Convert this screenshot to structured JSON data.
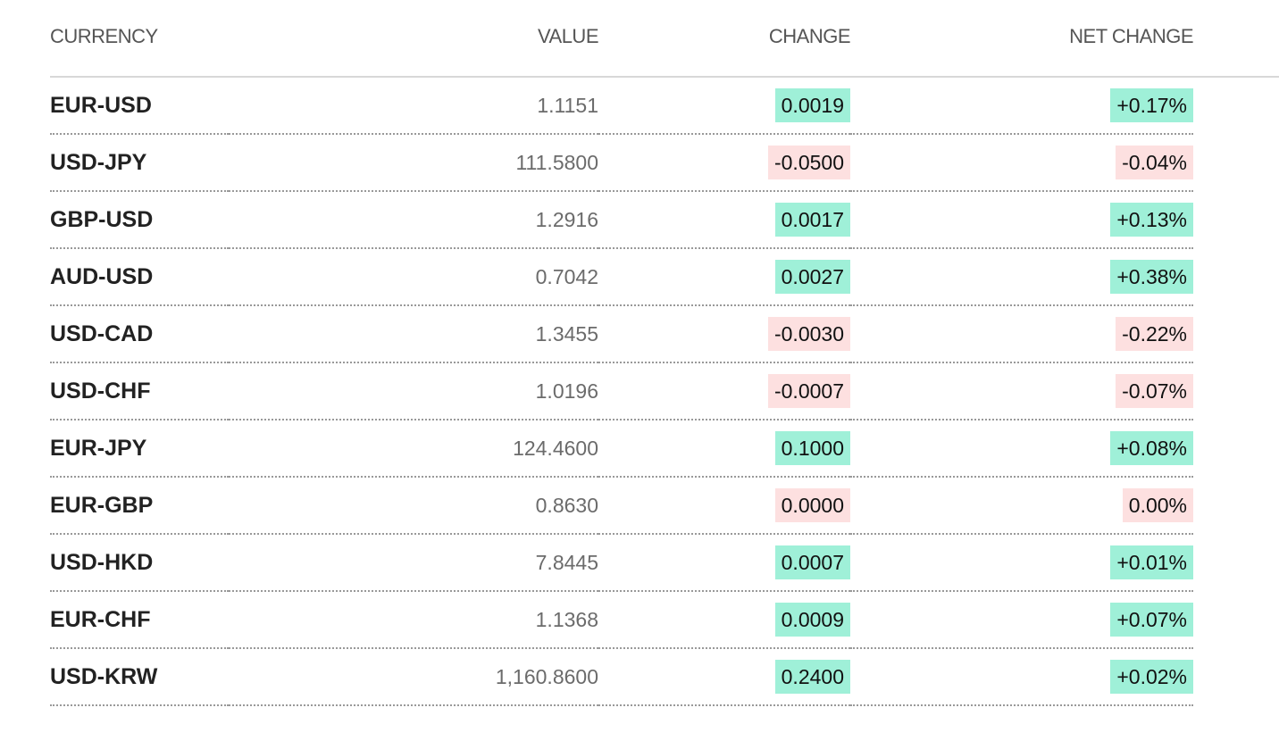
{
  "table": {
    "headers": {
      "currency": "CURRENCY",
      "value": "VALUE",
      "change": "CHANGE",
      "net_change": "NET CHANGE"
    },
    "colors": {
      "positive": "#9ff0d8",
      "negative": "#fde0e0"
    },
    "rows": [
      {
        "currency": "EUR-USD",
        "value": "1.1151",
        "change": "0.0019",
        "net_change": "+0.17%",
        "direction": "up"
      },
      {
        "currency": "USD-JPY",
        "value": "111.5800",
        "change": "-0.0500",
        "net_change": "-0.04%",
        "direction": "down"
      },
      {
        "currency": "GBP-USD",
        "value": "1.2916",
        "change": "0.0017",
        "net_change": "+0.13%",
        "direction": "up"
      },
      {
        "currency": "AUD-USD",
        "value": "0.7042",
        "change": "0.0027",
        "net_change": "+0.38%",
        "direction": "up"
      },
      {
        "currency": "USD-CAD",
        "value": "1.3455",
        "change": "-0.0030",
        "net_change": "-0.22%",
        "direction": "down"
      },
      {
        "currency": "USD-CHF",
        "value": "1.0196",
        "change": "-0.0007",
        "net_change": "-0.07%",
        "direction": "down"
      },
      {
        "currency": "EUR-JPY",
        "value": "124.4600",
        "change": "0.1000",
        "net_change": "+0.08%",
        "direction": "up"
      },
      {
        "currency": "EUR-GBP",
        "value": "0.8630",
        "change": "0.0000",
        "net_change": "0.00%",
        "direction": "down"
      },
      {
        "currency": "USD-HKD",
        "value": "7.8445",
        "change": "0.0007",
        "net_change": "+0.01%",
        "direction": "up"
      },
      {
        "currency": "EUR-CHF",
        "value": "1.1368",
        "change": "0.0009",
        "net_change": "+0.07%",
        "direction": "up"
      },
      {
        "currency": "USD-KRW",
        "value": "1,160.8600",
        "change": "0.2400",
        "net_change": "+0.02%",
        "direction": "up"
      }
    ]
  }
}
